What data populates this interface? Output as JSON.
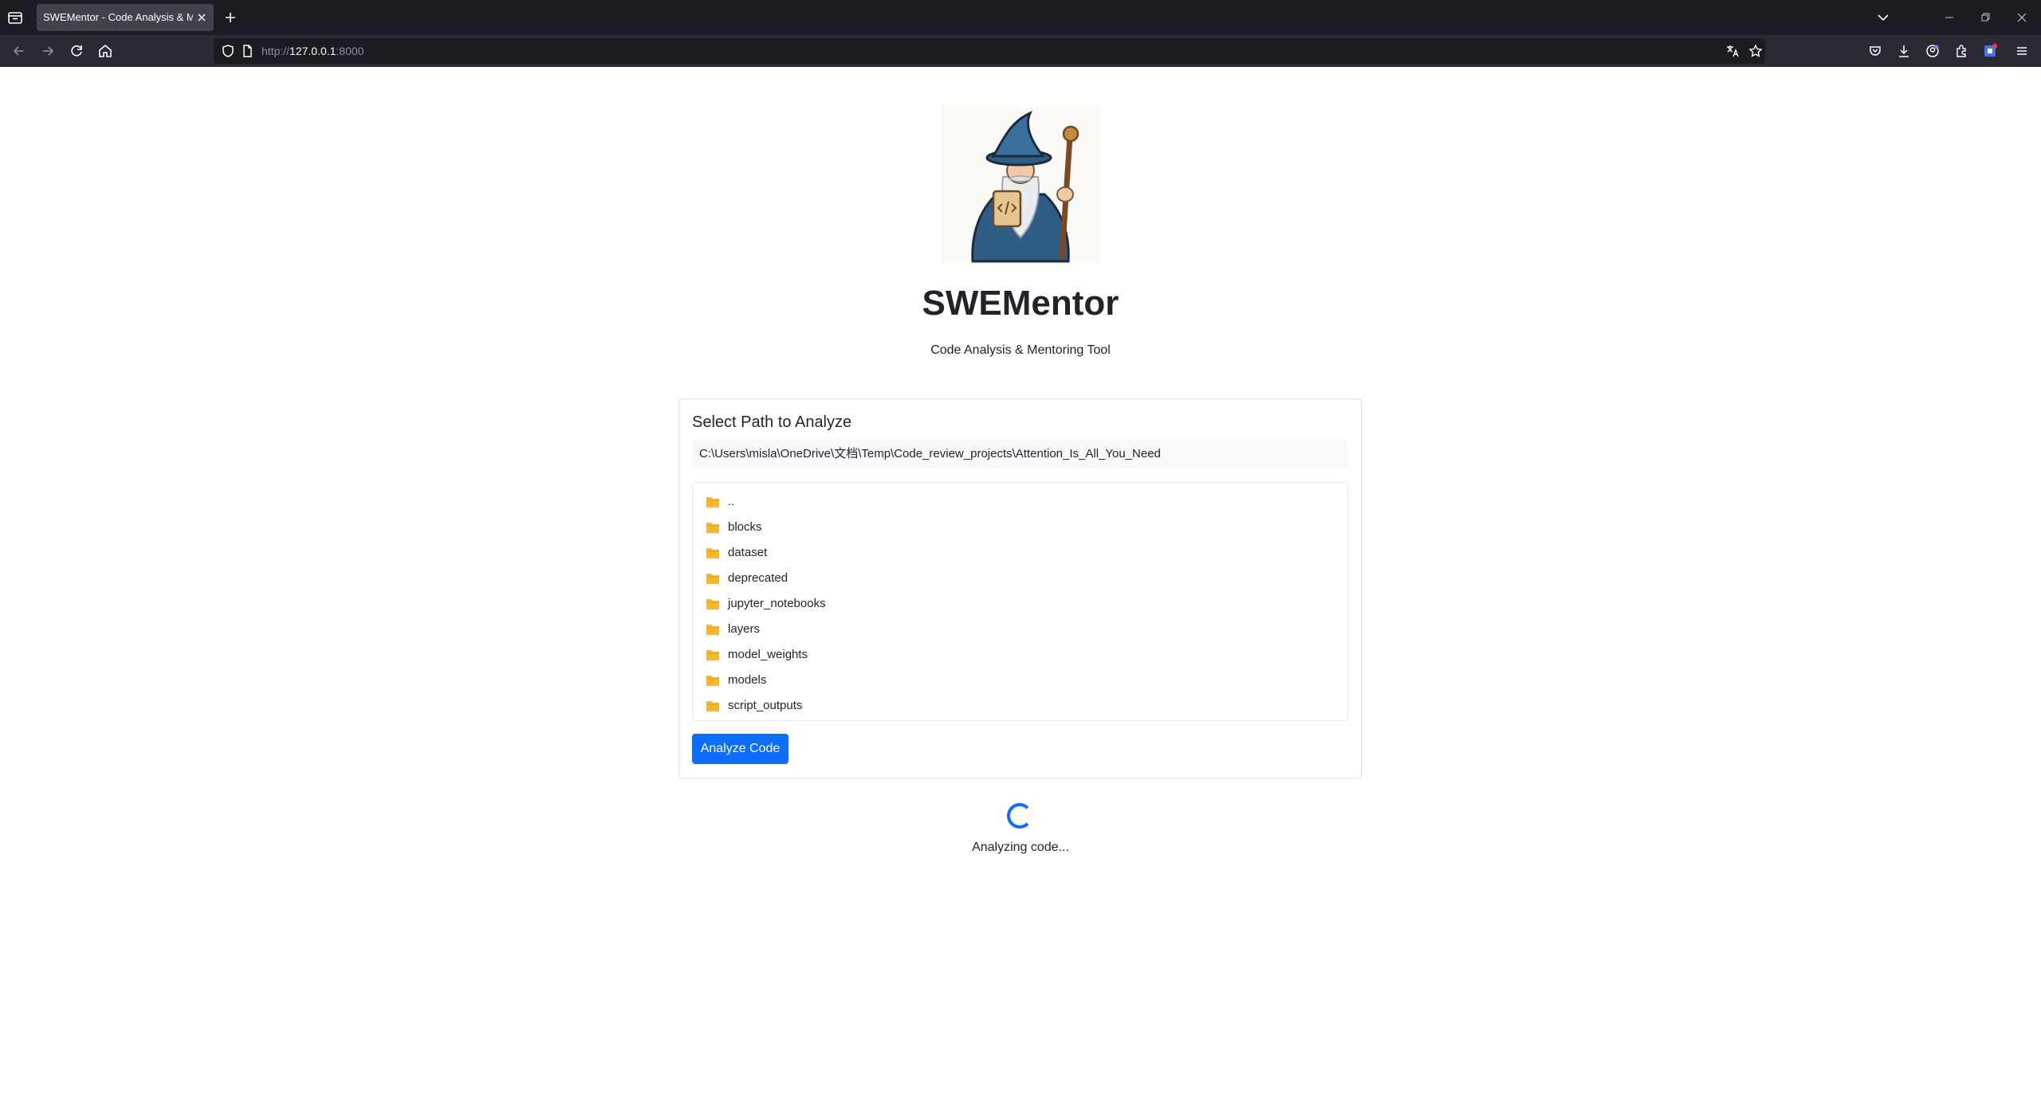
{
  "browser": {
    "tab_title": "SWEMentor - Code Analysis & Mentoring Tool",
    "url_scheme": "http://",
    "url_host": "127.0.0.1",
    "url_rest": ":8000"
  },
  "app": {
    "title": "SWEMentor",
    "subtitle": "Code Analysis & Mentoring Tool"
  },
  "selector": {
    "heading": "Select Path to Analyze",
    "path_value": "C:\\Users\\misla\\OneDrive\\文档\\Temp\\Code_review_projects\\Attention_Is_All_You_Need",
    "items": [
      {
        "name": ".."
      },
      {
        "name": "blocks"
      },
      {
        "name": "dataset"
      },
      {
        "name": "deprecated"
      },
      {
        "name": "jupyter_notebooks"
      },
      {
        "name": "layers"
      },
      {
        "name": "model_weights"
      },
      {
        "name": "models"
      },
      {
        "name": "script_outputs"
      }
    ],
    "analyze_label": "Analyze Code"
  },
  "status": {
    "text": "Analyzing code..."
  },
  "colors": {
    "accent": "#0d6efd",
    "folder": "#f5b82e",
    "chrome_dark": "#1c1b22",
    "chrome_toolbar": "#2b2a33"
  }
}
